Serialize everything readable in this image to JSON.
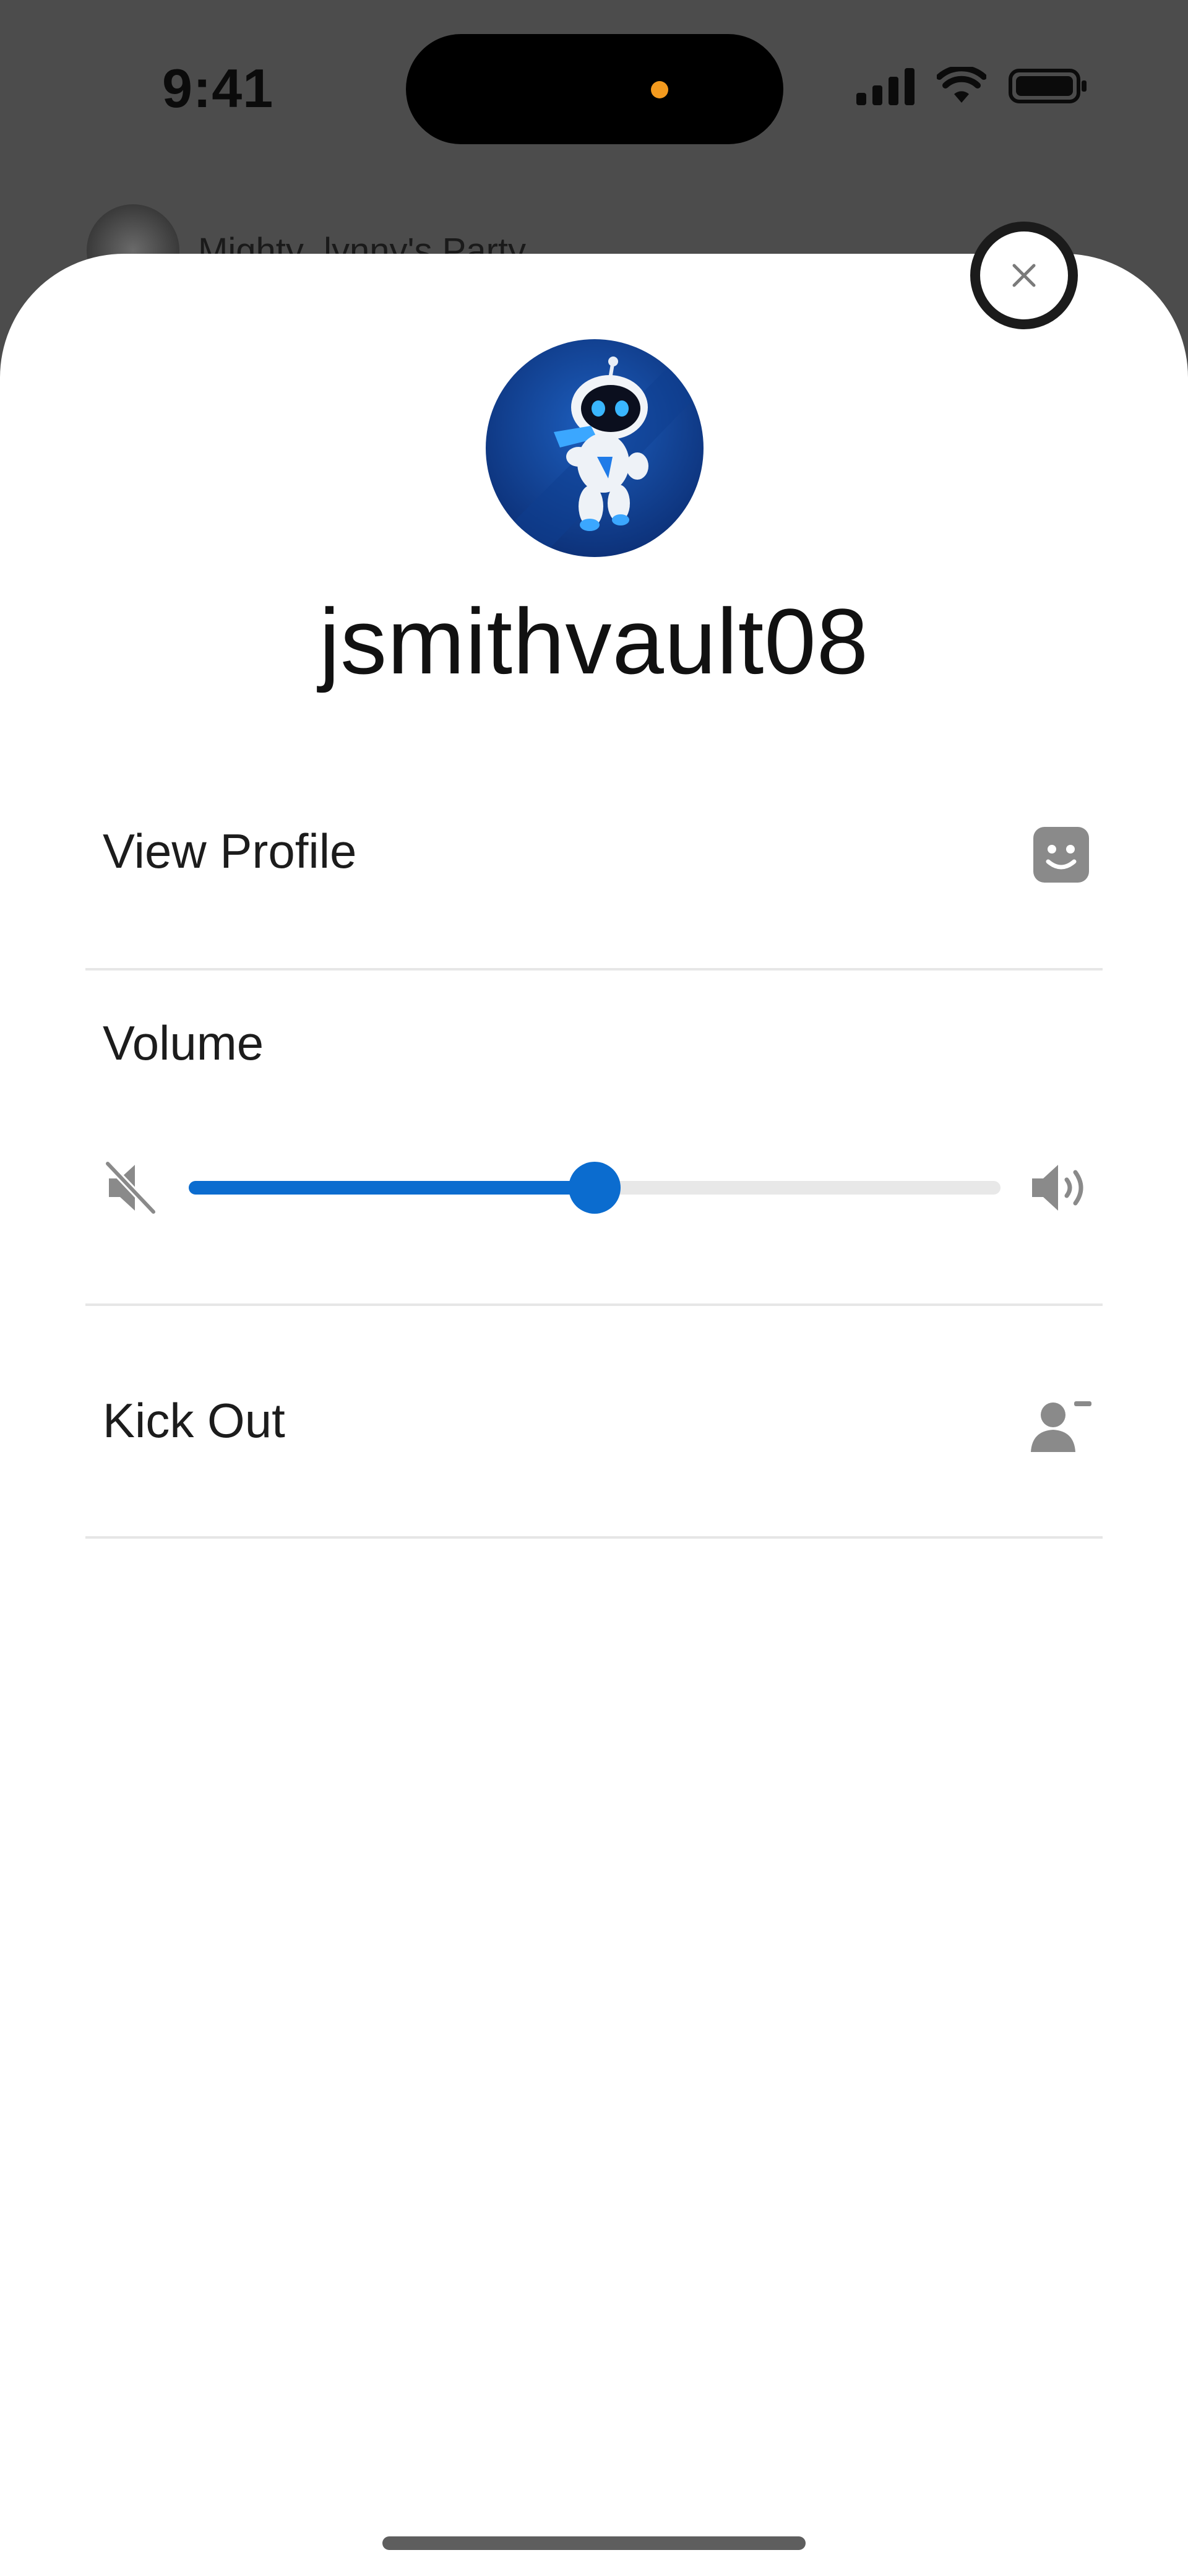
{
  "status_bar": {
    "time": "9:41"
  },
  "background": {
    "party_name": "Mighty_lynny's Party"
  },
  "sheet": {
    "username": "jsmithvault08",
    "menu": {
      "view_profile": "View Profile",
      "volume": "Volume",
      "kick_out": "Kick Out"
    },
    "volume_level": 0.5
  },
  "icons": {
    "close": "close-icon",
    "profile": "face-icon",
    "mute": "speaker-muted-icon",
    "volume_max": "speaker-loud-icon",
    "kick": "person-remove-icon"
  },
  "colors": {
    "accent": "#0b6ccf",
    "icon_gray": "#8a8a8a"
  }
}
